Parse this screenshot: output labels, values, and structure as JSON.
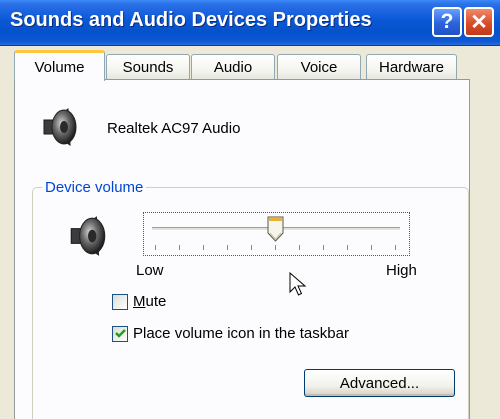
{
  "window": {
    "title": "Sounds and Audio Devices Properties",
    "help_label": "?",
    "close_label": "✕"
  },
  "tabs": [
    {
      "label": "Volume",
      "active": true
    },
    {
      "label": "Sounds",
      "active": false
    },
    {
      "label": "Audio",
      "active": false
    },
    {
      "label": "Voice",
      "active": false
    },
    {
      "label": "Hardware",
      "active": false
    }
  ],
  "device": {
    "icon": "speaker-icon",
    "name": "Realtek AC97 Audio"
  },
  "device_volume": {
    "group_label": "Device volume",
    "icon": "speaker-icon",
    "slider": {
      "low_label": "Low",
      "high_label": "High",
      "value_fraction": 0.5
    },
    "mute": {
      "label": "Mute",
      "checked": false
    },
    "taskbar_icon": {
      "label": "Place volume icon in the taskbar",
      "checked": true
    }
  },
  "buttons": {
    "advanced_label": "Advanced..."
  },
  "colors": {
    "titlebar": "#0a58d6",
    "group_label": "#0046d5",
    "active_tab_accent": "#ffc83c"
  }
}
